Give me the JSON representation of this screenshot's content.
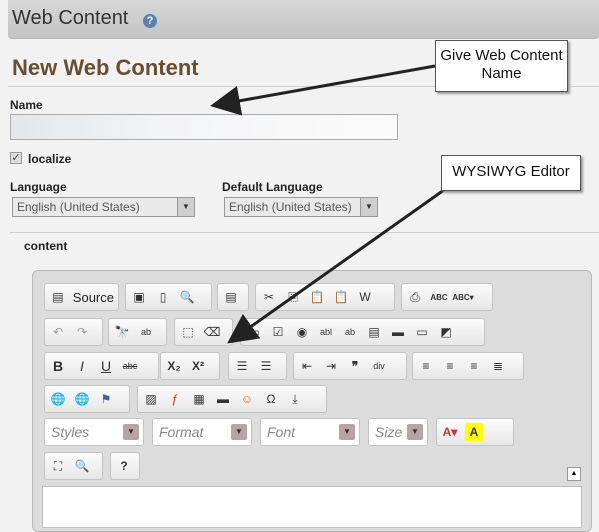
{
  "header": {
    "title": "Web Content",
    "help_icon": "?"
  },
  "page_title": "New Web Content",
  "form": {
    "name_label": "Name",
    "name_value": "",
    "localize_label": "localize",
    "localize_checked": true,
    "language_label": "Language",
    "language_value": "English (United States)",
    "default_language_label": "Default Language",
    "default_language_value": "English (United States)",
    "content_label": "content"
  },
  "editor": {
    "source_label": "Source",
    "combos": {
      "styles": "Styles",
      "format": "Format",
      "font": "Font",
      "size": "Size"
    },
    "toolbar_icons": [
      "source",
      "save",
      "new-page",
      "preview",
      "templates",
      "cut",
      "copy",
      "paste",
      "paste-text",
      "paste-word",
      "print",
      "spellcheck",
      "scayt",
      "undo",
      "redo",
      "find",
      "replace",
      "select-all",
      "remove-format",
      "form",
      "checkbox",
      "radio",
      "text-field",
      "textarea",
      "select",
      "button",
      "image-button",
      "hidden-field",
      "bold",
      "italic",
      "underline",
      "strike",
      "subscript",
      "superscript",
      "numbered-list",
      "bulleted-list",
      "outdent",
      "indent",
      "blockquote",
      "div",
      "align-left",
      "align-center",
      "align-right",
      "justify",
      "link",
      "unlink",
      "anchor",
      "image",
      "flash",
      "table",
      "horizontal-rule",
      "smiley",
      "special-char",
      "page-break",
      "text-color",
      "bg-color",
      "maximize",
      "show-blocks",
      "about"
    ]
  },
  "annotations": {
    "callout_name": "Give Web Content Name",
    "callout_editor": "WYSIWYG Editor"
  }
}
